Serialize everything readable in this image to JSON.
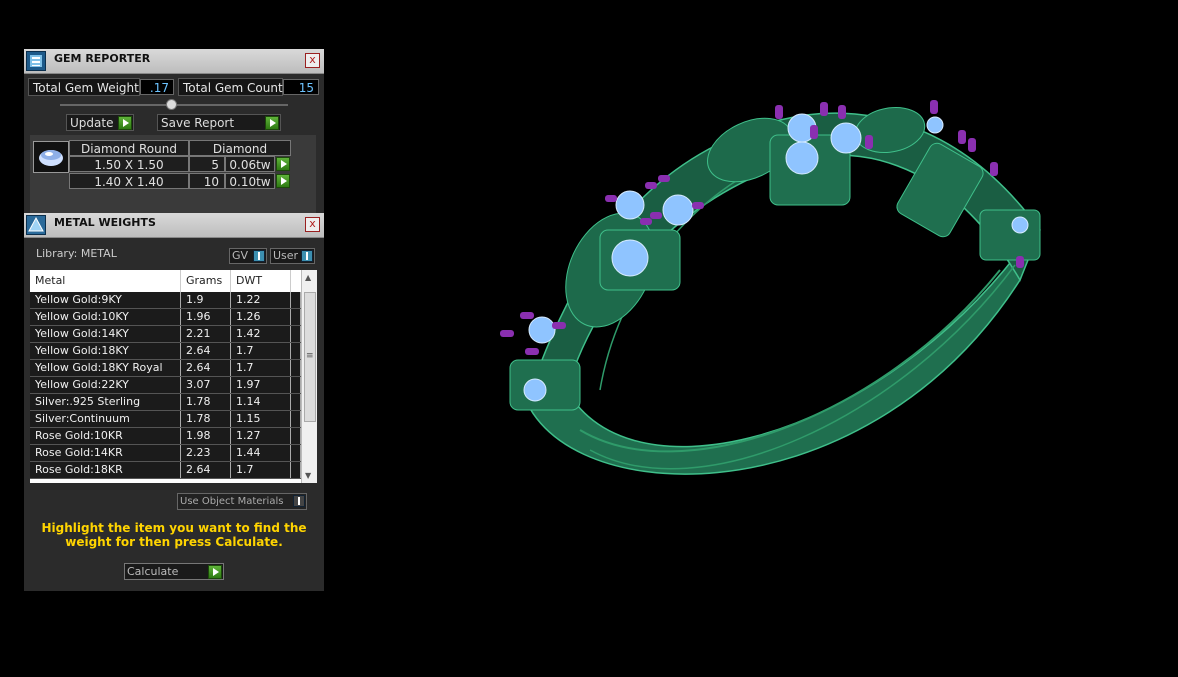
{
  "gem_reporter": {
    "title": "GEM REPORTER",
    "close_label": "x",
    "total_gem_weight_label": "Total Gem Weight",
    "total_gem_weight_value": ".17",
    "total_gem_count_label": "Total Gem Count",
    "total_gem_count_value": "15",
    "update_label": "Update",
    "save_report_label": "Save Report",
    "header": [
      "Diamond Round",
      "Diamond"
    ],
    "rows": [
      {
        "size": "1.50 X 1.50",
        "count": "5",
        "weight": "0.06tw"
      },
      {
        "size": "1.40 X 1.40",
        "count": "10",
        "weight": "0.10tw"
      }
    ]
  },
  "metal_weights": {
    "title": "METAL WEIGHTS",
    "close_label": "x",
    "library_label": "Library: METAL",
    "gv_label": "GV",
    "user_label": "User",
    "columns": [
      "Metal",
      "Grams",
      "DWT"
    ],
    "rows": [
      [
        "Yellow Gold:9KY",
        "1.9",
        "1.22"
      ],
      [
        "Yellow Gold:10KY",
        "1.96",
        "1.26"
      ],
      [
        "Yellow Gold:14KY",
        "2.21",
        "1.42"
      ],
      [
        "Yellow Gold:18KY",
        "2.64",
        "1.7"
      ],
      [
        "Yellow Gold:18KY Royal",
        "2.64",
        "1.7"
      ],
      [
        "Yellow Gold:22KY",
        "3.07",
        "1.97"
      ],
      [
        "Silver:.925 Sterling",
        "1.78",
        "1.14"
      ],
      [
        "Silver:Continuum",
        "1.78",
        "1.15"
      ],
      [
        "Rose Gold:10KR",
        "1.98",
        "1.27"
      ],
      [
        "Rose Gold:14KR",
        "2.23",
        "1.44"
      ],
      [
        "Rose Gold:18KR",
        "2.64",
        "1.7"
      ]
    ],
    "use_object_materials_label": "Use Object Materials",
    "hint": "Highlight the item you want to find the weight for then press Calculate.",
    "calculate_label": "Calculate"
  },
  "colors": {
    "ring_green": "#1f6f4f",
    "gem_blue": "#8fc4ff",
    "prong_purple": "#8a2fb0",
    "hint_yellow": "#ffd400"
  },
  "icons": [
    "gem-reporter-icon",
    "metal-weights-icon",
    "diamond-thumbnail-icon",
    "play-arrow-icon",
    "close-icon"
  ]
}
